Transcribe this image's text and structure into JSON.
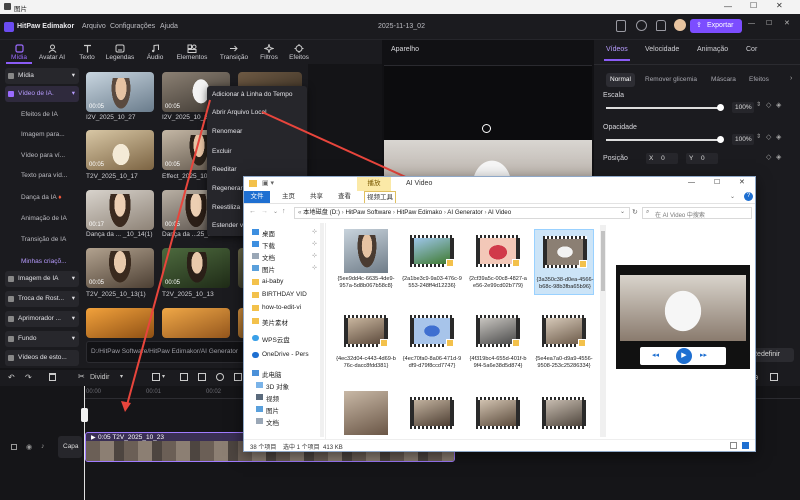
{
  "viewer": {
    "title": "图片"
  },
  "editor": {
    "app_name": "HitPaw Edimakor",
    "menus": [
      "Arquivo",
      "Configurações",
      "Ajuda"
    ],
    "project_name": "2025-11-13_02",
    "export_label": "Exportar"
  },
  "toolbar": {
    "tools": [
      {
        "label": "Mídia",
        "icon": "media-icon"
      },
      {
        "label": "Avatar AI",
        "icon": "avatar-icon"
      },
      {
        "label": "Texto",
        "icon": "text-icon"
      },
      {
        "label": "Legendas",
        "icon": "subtitles-icon"
      },
      {
        "label": "Áudio",
        "icon": "audio-icon"
      },
      {
        "label": "Elementos",
        "icon": "elements-icon"
      },
      {
        "label": "Transição",
        "icon": "transition-icon"
      },
      {
        "label": "Filtros",
        "icon": "filters-icon"
      },
      {
        "label": "Efeitos",
        "icon": "effects-icon"
      }
    ]
  },
  "sidebar": {
    "items": [
      {
        "label": "Mídia"
      },
      {
        "label": "Vídeo de IA."
      },
      {
        "label": "Efeitos de IA"
      },
      {
        "label": "Imagem para..."
      },
      {
        "label": "Vídeo para ví..."
      },
      {
        "label": "Texto para víd..."
      },
      {
        "label": "Dança da IA"
      },
      {
        "label": "Animação de IA"
      },
      {
        "label": "Transição de IA"
      },
      {
        "label": "Minhas criaçõ..."
      },
      {
        "label": "Imagem de IA"
      },
      {
        "label": "Troca de Rost..."
      },
      {
        "label": "Aprimorador ..."
      },
      {
        "label": "Fundo"
      },
      {
        "label": "Vídeos de esto..."
      }
    ]
  },
  "media": {
    "items": [
      {
        "label": "I2V_2025_10_27",
        "duration": "00:05"
      },
      {
        "label": "I2V_2025_10_2",
        "duration": "00:05"
      },
      {
        "label": "T2V_2025_10_17",
        "duration": "00:05"
      },
      {
        "label": "Effect_2025_10",
        "duration": "00:05"
      },
      {
        "label": "Dança da ... _10_14(1)",
        "duration": "00:17"
      },
      {
        "label": "Dança da ...25_10",
        "duration": "00:05"
      },
      {
        "label": "T2V_2025_10_13(1)",
        "duration": "00:05"
      },
      {
        "label": "T2V_2025_10_13",
        "duration": "00:05"
      }
    ],
    "path": "D:/HitPaw Software/HitPaw Edimakor/AI Generator"
  },
  "context_menu": {
    "items": [
      "Adicionar à Linha do Tempo",
      "Abrir Arquivo Local",
      "Renomear",
      "Excluir",
      "Reeditar",
      "Regenerar",
      "Reestiliza",
      "Estender v"
    ]
  },
  "preview": {
    "title": "Aparelho"
  },
  "props": {
    "tabs": [
      "Vídeos",
      "Velocidade",
      "Animação",
      "Cor"
    ],
    "subtabs": [
      "Normal",
      "Remover glicemia",
      "Máscara",
      "Efeitos"
    ],
    "scale_label": "Escala",
    "scale_value": "100%",
    "scale_level": 1.0,
    "opacity_label": "Opacidade",
    "opacity_value": "100%",
    "opacity_level": 1.0,
    "position_label": "Posição",
    "x_label": "X",
    "x_value": "0",
    "y_label": "Y",
    "y_value": "0",
    "redefine_label": "Redefinir"
  },
  "tl_toolbar": {
    "split_label": "Dividir"
  },
  "timeline": {
    "clip_label": "0:05 T2V_2025_10_23",
    "track_label": "Capa",
    "ruler": [
      "00:00",
      "00:01",
      "00:02"
    ]
  },
  "explorer": {
    "title": "AI Video",
    "ribbon_tabs": [
      "文件",
      "主页",
      "共享",
      "查看",
      "视频工具"
    ],
    "ribbon_context": "播放",
    "breadcrumb": [
      "本地磁盘 (D:)",
      "HitPaw Software",
      "HitPaw Edimako",
      "AI Generator",
      "AI Video"
    ],
    "search_placeholder": "在 AI Video 中搜索",
    "nav": [
      {
        "label": "桌面",
        "icon": "desktop-folder-icon"
      },
      {
        "label": "下载",
        "icon": "download-folder-icon"
      },
      {
        "label": "文档",
        "icon": "documents-folder-icon"
      },
      {
        "label": "图片",
        "icon": "pictures-folder-icon"
      },
      {
        "label": "ai-baby",
        "icon": "folder-icon"
      },
      {
        "label": "BIRTHDAY VID",
        "icon": "folder-icon"
      },
      {
        "label": "how-to-edit-vi",
        "icon": "folder-icon"
      },
      {
        "label": "美片素材",
        "icon": "folder-icon"
      },
      {
        "label": "WPS云盘",
        "icon": "cloud-icon"
      },
      {
        "label": "OneDrive - Pers",
        "icon": "onedrive-icon"
      },
      {
        "label": "此电脑",
        "icon": "pc-icon"
      },
      {
        "label": "3D 对象",
        "icon": "3d-icon"
      },
      {
        "label": "视频",
        "icon": "videos-icon"
      },
      {
        "label": "图片",
        "icon": "pictures-icon"
      },
      {
        "label": "文档",
        "icon": "documents-icon"
      }
    ],
    "files": [
      {
        "name": "{5ee9dd4c-6635-4de9-957a-5d8b067b58c8}",
        "kind": "image"
      },
      {
        "name": "{2a1be3c9-9a03-476c-9553-248ff4d12236}",
        "kind": "video"
      },
      {
        "name": "{2cf39a5c-00c8-4827-ae56-2e99cd02b779}",
        "kind": "video"
      },
      {
        "name": "{2f339bc5-cd3b-4cc6-aa2d-1bb9e6f6ea3c}",
        "kind": "video"
      },
      {
        "name": "{3a350c38-d0ea-4566-b68c-98b3fba65b96}",
        "kind": "video"
      },
      {
        "name": "{4ec32d04-c443-4d69-b76c-dacc8fdd381}",
        "kind": "video"
      },
      {
        "name": "{4ec70fa0-8a06-471d-9df9-d79f8ccd7747}",
        "kind": "video"
      },
      {
        "name": "{4f319bc4-655d-401f-b9f4-5a6e38d5d874}",
        "kind": "video"
      },
      {
        "name": "{5e4ea7a0-d9a9-4556-9508-253c25286334}",
        "kind": "video"
      },
      {
        "name": "",
        "kind": "image"
      },
      {
        "name": "",
        "kind": "video"
      },
      {
        "name": "",
        "kind": "video"
      },
      {
        "name": "",
        "kind": "video"
      },
      {
        "name": "",
        "kind": "video"
      }
    ],
    "status": "38 个项目    选中 1 个项目  413 KB",
    "help": "?"
  }
}
